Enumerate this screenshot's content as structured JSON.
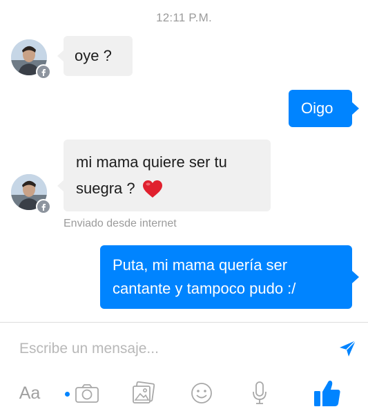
{
  "header": {
    "timestamp": "12:11 P.M."
  },
  "messages": [
    {
      "from": "them",
      "lines": [
        "oye ?"
      ]
    },
    {
      "from": "me",
      "lines": [
        "Oigo"
      ]
    },
    {
      "from": "them",
      "lines": [
        "mi mama quiere ser tu",
        "suegra ?"
      ],
      "emoji": "heart"
    },
    {
      "from": "me",
      "lines": [
        "Puta, mi mama quería ser",
        "cantante y tampoco pudo :/"
      ]
    }
  ],
  "status": {
    "sent_from": "Enviado desde internet"
  },
  "composer": {
    "placeholder": "Escribe un mensaje..."
  },
  "toolbar": {
    "text_label": "Aa",
    "icons": [
      "camera-icon",
      "gallery-icon",
      "emoji-icon",
      "microphone-icon",
      "like-icon"
    ]
  },
  "colors": {
    "outgoing": "#0084ff",
    "incoming": "#f0f0f0",
    "heart": "#e0202e"
  }
}
